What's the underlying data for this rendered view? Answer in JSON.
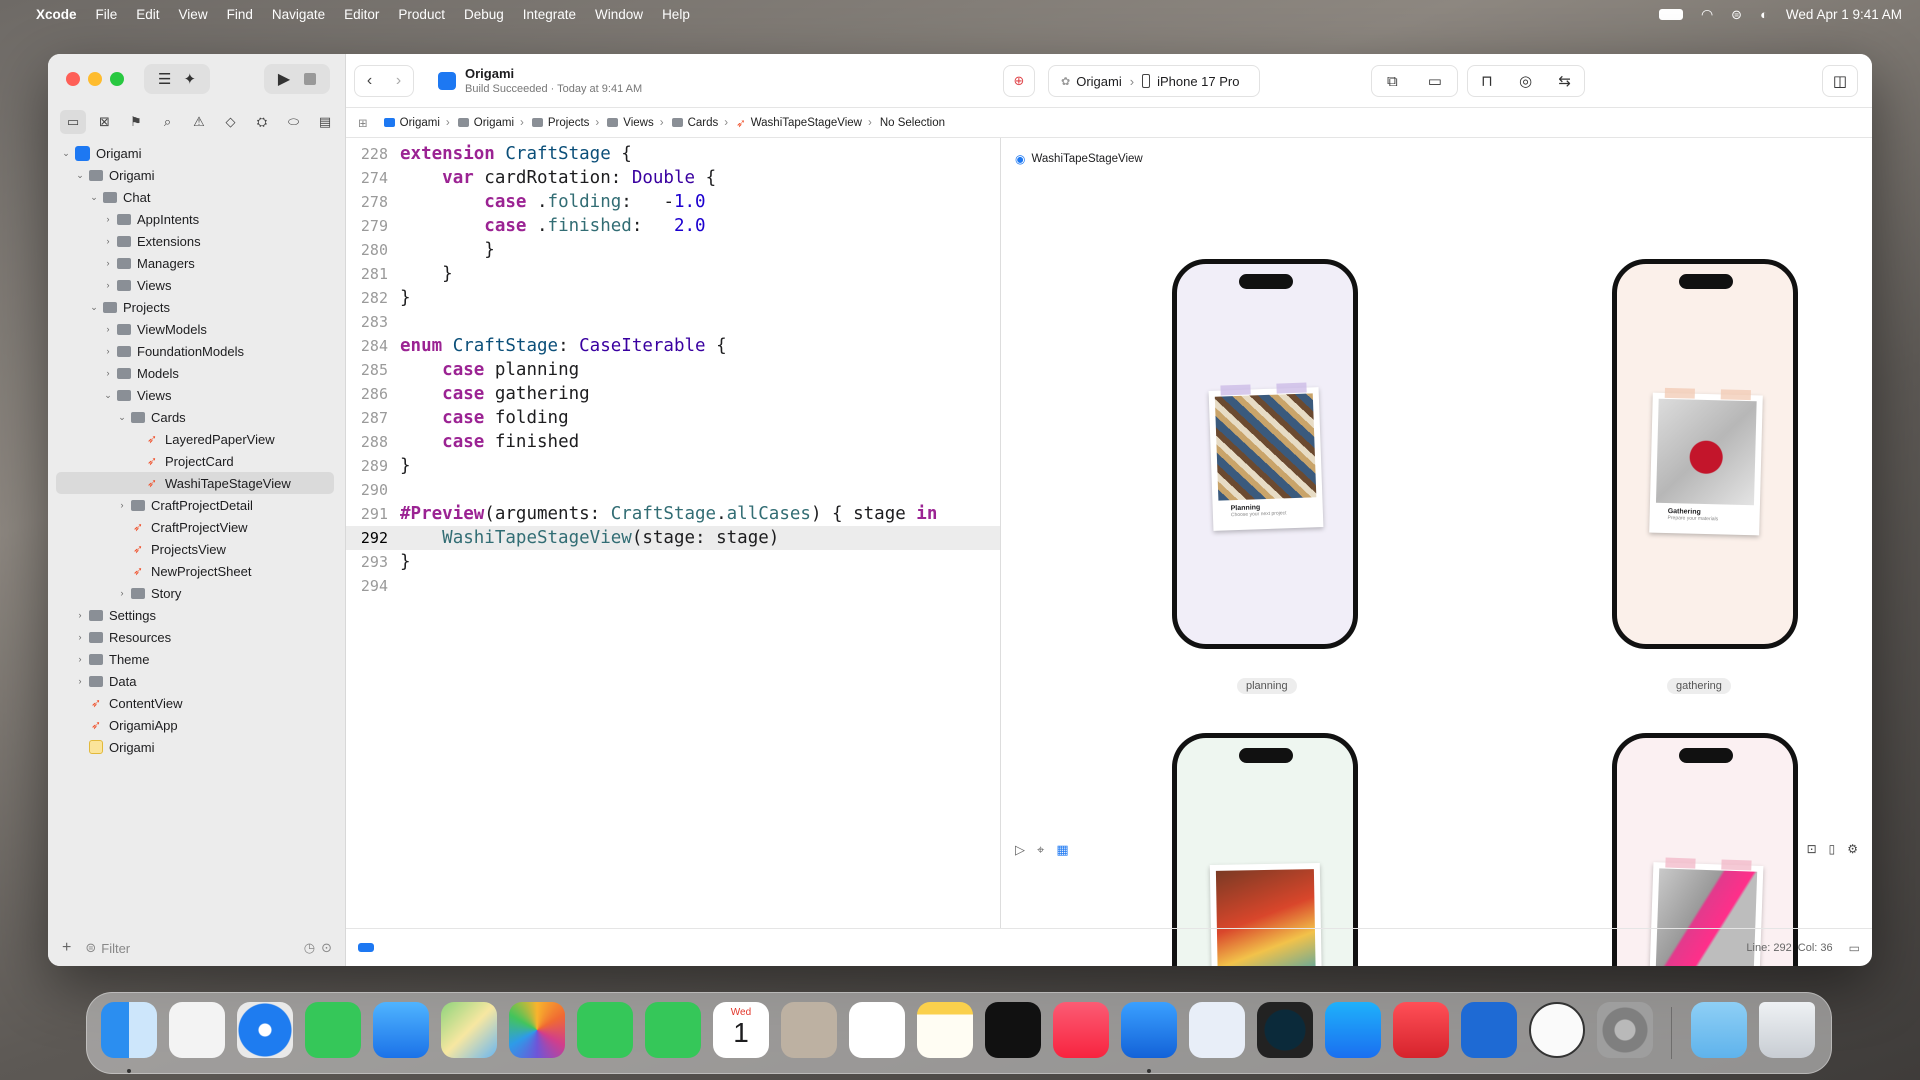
{
  "menubar": {
    "app": "Xcode",
    "items": [
      "File",
      "Edit",
      "View",
      "Find",
      "Navigate",
      "Editor",
      "Product",
      "Debug",
      "Integrate",
      "Window",
      "Help"
    ],
    "clock": "Wed Apr 1  9:41 AM"
  },
  "toolbar": {
    "project": "Origami",
    "build_status": "Build Succeeded · Today at 9:41 AM",
    "scheme": "Origami",
    "device": "iPhone 17 Pro"
  },
  "breadcrumb": [
    "Origami",
    "Origami",
    "Projects",
    "Views",
    "Cards",
    "WashiTapeStageView",
    "No Selection"
  ],
  "navigator": {
    "rows": [
      {
        "label": "Origami",
        "icon": "project",
        "depth": 0,
        "chev": "v"
      },
      {
        "label": "Origami",
        "icon": "folder",
        "depth": 1,
        "chev": "v"
      },
      {
        "label": "Chat",
        "icon": "folder",
        "depth": 2,
        "chev": "v"
      },
      {
        "label": "AppIntents",
        "icon": "folder",
        "depth": 3,
        "chev": ">"
      },
      {
        "label": "Extensions",
        "icon": "folder",
        "depth": 3,
        "chev": ">"
      },
      {
        "label": "Managers",
        "icon": "folder",
        "depth": 3,
        "chev": ">"
      },
      {
        "label": "Views",
        "icon": "folder",
        "depth": 3,
        "chev": ">"
      },
      {
        "label": "Projects",
        "icon": "folder",
        "depth": 2,
        "chev": "v"
      },
      {
        "label": "ViewModels",
        "icon": "folder",
        "depth": 3,
        "chev": ">"
      },
      {
        "label": "FoundationModels",
        "icon": "folder",
        "depth": 3,
        "chev": ">"
      },
      {
        "label": "Models",
        "icon": "folder",
        "depth": 3,
        "chev": ">"
      },
      {
        "label": "Views",
        "icon": "folder",
        "depth": 3,
        "chev": "v"
      },
      {
        "label": "Cards",
        "icon": "folder",
        "depth": 4,
        "chev": "v"
      },
      {
        "label": "LayeredPaperView",
        "icon": "swift",
        "depth": 5,
        "chev": ""
      },
      {
        "label": "ProjectCard",
        "icon": "swift",
        "depth": 5,
        "chev": ""
      },
      {
        "label": "WashiTapeStageView",
        "icon": "swift",
        "depth": 5,
        "chev": "",
        "selected": true
      },
      {
        "label": "CraftProjectDetail",
        "icon": "folder",
        "depth": 4,
        "chev": ">"
      },
      {
        "label": "CraftProjectView",
        "icon": "swift",
        "depth": 4,
        "chev": ""
      },
      {
        "label": "ProjectsView",
        "icon": "swift",
        "depth": 4,
        "chev": ""
      },
      {
        "label": "NewProjectSheet",
        "icon": "swift",
        "depth": 4,
        "chev": ""
      },
      {
        "label": "Story",
        "icon": "folder",
        "depth": 4,
        "chev": ">"
      },
      {
        "label": "Settings",
        "icon": "folder",
        "depth": 1,
        "chev": ">"
      },
      {
        "label": "Resources",
        "icon": "folder",
        "depth": 1,
        "chev": ">"
      },
      {
        "label": "Theme",
        "icon": "folder",
        "depth": 1,
        "chev": ">"
      },
      {
        "label": "Data",
        "icon": "folder",
        "depth": 1,
        "chev": ">"
      },
      {
        "label": "ContentView",
        "icon": "swift",
        "depth": 1,
        "chev": ""
      },
      {
        "label": "OrigamiApp",
        "icon": "swift",
        "depth": 1,
        "chev": ""
      },
      {
        "label": "Origami",
        "icon": "asset",
        "depth": 1,
        "chev": ""
      }
    ],
    "filter_placeholder": "Filter"
  },
  "code": [
    {
      "n": "228",
      "html": "<span class='k'>extension</span> <span class='t'>CraftStage</span> {"
    },
    {
      "n": "274",
      "html": "    <span class='k'>var</span> cardRotation: <span class='t2'>Double</span> {"
    },
    {
      "n": "278",
      "html": "        <span class='k'>case</span> .<span class='p'>folding</span>:   -<span class='n'>1.0</span>"
    },
    {
      "n": "279",
      "html": "        <span class='k'>case</span> .<span class='p'>finished</span>:   <span class='n'>2.0</span>"
    },
    {
      "n": "280",
      "html": "        }"
    },
    {
      "n": "281",
      "html": "    }"
    },
    {
      "n": "282",
      "html": "}"
    },
    {
      "n": "283",
      "html": ""
    },
    {
      "n": "284",
      "html": "<span class='k'>enum</span> <span class='t'>CraftStage</span>: <span class='t2'>CaseIterable</span> {"
    },
    {
      "n": "285",
      "html": "    <span class='k'>case</span> planning"
    },
    {
      "n": "286",
      "html": "    <span class='k'>case</span> gathering"
    },
    {
      "n": "287",
      "html": "    <span class='k'>case</span> folding"
    },
    {
      "n": "288",
      "html": "    <span class='k'>case</span> finished"
    },
    {
      "n": "289",
      "html": "}"
    },
    {
      "n": "290",
      "html": ""
    },
    {
      "n": "291",
      "html": "<span class='k'>#Preview</span>(arguments: <span class='p'>CraftStage</span>.<span class='p'>allCases</span>) { stage <span class='k'>in</span>"
    },
    {
      "n": "292",
      "html": "    <span class='p'>WashiTapeStageView</span>(stage: stage)",
      "current": true
    },
    {
      "n": "293",
      "html": "}"
    },
    {
      "n": "294",
      "html": ""
    }
  ],
  "canvas": {
    "title": "WashiTapeStageView",
    "previews": [
      {
        "label": "planning",
        "card_title": "Planning",
        "card_sub": "Choose your next project"
      },
      {
        "label": "gathering",
        "card_title": "Gathering",
        "card_sub": "Prepare your materials"
      },
      {
        "label": "",
        "card_title": "",
        "card_sub": ""
      },
      {
        "label": "",
        "card_title": "",
        "card_sub": ""
      }
    ]
  },
  "statusbar": {
    "position": "Line: 292  Col: 36"
  },
  "dock": {
    "calendar_day": "Wed",
    "calendar_date": "1",
    "apps": [
      "finder-icon",
      "launchpad-icon",
      "safari-icon",
      "messages-icon",
      "mail-icon",
      "maps-icon",
      "photos-icon",
      "facetime-icon",
      "phone-icon",
      "calendar-icon",
      "contacts-icon",
      "reminders-icon",
      "notes-icon",
      "tv-icon",
      "music-icon",
      "xcode-icon",
      "preview-icon",
      "instruments-icon",
      "app-store-icon",
      "rocketsim-icon",
      "simulator-icon",
      "proxyman-icon",
      "system-settings-icon",
      "downloads-folder-icon",
      "trash-icon"
    ]
  }
}
